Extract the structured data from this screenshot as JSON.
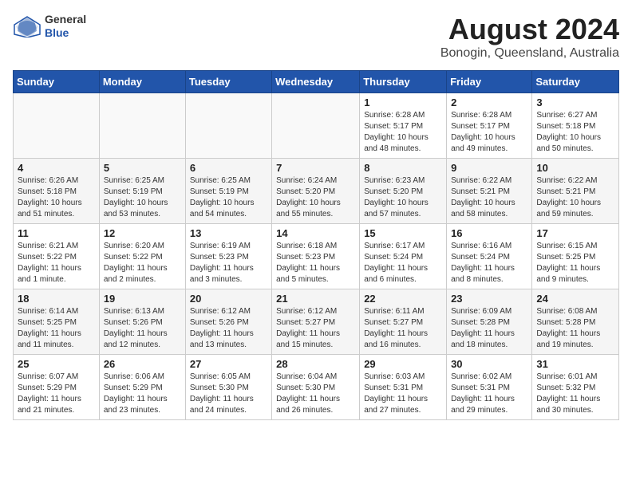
{
  "header": {
    "logo_line1": "General",
    "logo_line2": "Blue",
    "main_title": "August 2024",
    "subtitle": "Bonogin, Queensland, Australia"
  },
  "weekdays": [
    "Sunday",
    "Monday",
    "Tuesday",
    "Wednesday",
    "Thursday",
    "Friday",
    "Saturday"
  ],
  "weeks": [
    [
      {
        "day": "",
        "info": ""
      },
      {
        "day": "",
        "info": ""
      },
      {
        "day": "",
        "info": ""
      },
      {
        "day": "",
        "info": ""
      },
      {
        "day": "1",
        "info": "Sunrise: 6:28 AM\nSunset: 5:17 PM\nDaylight: 10 hours\nand 48 minutes."
      },
      {
        "day": "2",
        "info": "Sunrise: 6:28 AM\nSunset: 5:17 PM\nDaylight: 10 hours\nand 49 minutes."
      },
      {
        "day": "3",
        "info": "Sunrise: 6:27 AM\nSunset: 5:18 PM\nDaylight: 10 hours\nand 50 minutes."
      }
    ],
    [
      {
        "day": "4",
        "info": "Sunrise: 6:26 AM\nSunset: 5:18 PM\nDaylight: 10 hours\nand 51 minutes."
      },
      {
        "day": "5",
        "info": "Sunrise: 6:25 AM\nSunset: 5:19 PM\nDaylight: 10 hours\nand 53 minutes."
      },
      {
        "day": "6",
        "info": "Sunrise: 6:25 AM\nSunset: 5:19 PM\nDaylight: 10 hours\nand 54 minutes."
      },
      {
        "day": "7",
        "info": "Sunrise: 6:24 AM\nSunset: 5:20 PM\nDaylight: 10 hours\nand 55 minutes."
      },
      {
        "day": "8",
        "info": "Sunrise: 6:23 AM\nSunset: 5:20 PM\nDaylight: 10 hours\nand 57 minutes."
      },
      {
        "day": "9",
        "info": "Sunrise: 6:22 AM\nSunset: 5:21 PM\nDaylight: 10 hours\nand 58 minutes."
      },
      {
        "day": "10",
        "info": "Sunrise: 6:22 AM\nSunset: 5:21 PM\nDaylight: 10 hours\nand 59 minutes."
      }
    ],
    [
      {
        "day": "11",
        "info": "Sunrise: 6:21 AM\nSunset: 5:22 PM\nDaylight: 11 hours\nand 1 minute."
      },
      {
        "day": "12",
        "info": "Sunrise: 6:20 AM\nSunset: 5:22 PM\nDaylight: 11 hours\nand 2 minutes."
      },
      {
        "day": "13",
        "info": "Sunrise: 6:19 AM\nSunset: 5:23 PM\nDaylight: 11 hours\nand 3 minutes."
      },
      {
        "day": "14",
        "info": "Sunrise: 6:18 AM\nSunset: 5:23 PM\nDaylight: 11 hours\nand 5 minutes."
      },
      {
        "day": "15",
        "info": "Sunrise: 6:17 AM\nSunset: 5:24 PM\nDaylight: 11 hours\nand 6 minutes."
      },
      {
        "day": "16",
        "info": "Sunrise: 6:16 AM\nSunset: 5:24 PM\nDaylight: 11 hours\nand 8 minutes."
      },
      {
        "day": "17",
        "info": "Sunrise: 6:15 AM\nSunset: 5:25 PM\nDaylight: 11 hours\nand 9 minutes."
      }
    ],
    [
      {
        "day": "18",
        "info": "Sunrise: 6:14 AM\nSunset: 5:25 PM\nDaylight: 11 hours\nand 11 minutes."
      },
      {
        "day": "19",
        "info": "Sunrise: 6:13 AM\nSunset: 5:26 PM\nDaylight: 11 hours\nand 12 minutes."
      },
      {
        "day": "20",
        "info": "Sunrise: 6:12 AM\nSunset: 5:26 PM\nDaylight: 11 hours\nand 13 minutes."
      },
      {
        "day": "21",
        "info": "Sunrise: 6:12 AM\nSunset: 5:27 PM\nDaylight: 11 hours\nand 15 minutes."
      },
      {
        "day": "22",
        "info": "Sunrise: 6:11 AM\nSunset: 5:27 PM\nDaylight: 11 hours\nand 16 minutes."
      },
      {
        "day": "23",
        "info": "Sunrise: 6:09 AM\nSunset: 5:28 PM\nDaylight: 11 hours\nand 18 minutes."
      },
      {
        "day": "24",
        "info": "Sunrise: 6:08 AM\nSunset: 5:28 PM\nDaylight: 11 hours\nand 19 minutes."
      }
    ],
    [
      {
        "day": "25",
        "info": "Sunrise: 6:07 AM\nSunset: 5:29 PM\nDaylight: 11 hours\nand 21 minutes."
      },
      {
        "day": "26",
        "info": "Sunrise: 6:06 AM\nSunset: 5:29 PM\nDaylight: 11 hours\nand 23 minutes."
      },
      {
        "day": "27",
        "info": "Sunrise: 6:05 AM\nSunset: 5:30 PM\nDaylight: 11 hours\nand 24 minutes."
      },
      {
        "day": "28",
        "info": "Sunrise: 6:04 AM\nSunset: 5:30 PM\nDaylight: 11 hours\nand 26 minutes."
      },
      {
        "day": "29",
        "info": "Sunrise: 6:03 AM\nSunset: 5:31 PM\nDaylight: 11 hours\nand 27 minutes."
      },
      {
        "day": "30",
        "info": "Sunrise: 6:02 AM\nSunset: 5:31 PM\nDaylight: 11 hours\nand 29 minutes."
      },
      {
        "day": "31",
        "info": "Sunrise: 6:01 AM\nSunset: 5:32 PM\nDaylight: 11 hours\nand 30 minutes."
      }
    ]
  ]
}
